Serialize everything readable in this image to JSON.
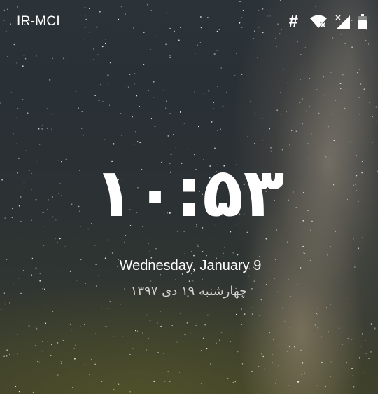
{
  "status_bar": {
    "carrier": "IR-MCI",
    "icons": [
      "hash-icon",
      "wifi-no-internet-icon",
      "cell-signal-no-service-icon",
      "battery-icon"
    ],
    "hash_glyph": "#"
  },
  "lockscreen": {
    "time": "۱۰:۵۳",
    "date": "Wednesday, January 9",
    "persian_date": "چهارشنبه ۱۹ دی ۱۳۹۷"
  },
  "colors": {
    "text": "#ffffff",
    "sky_dark": "#2a3034",
    "milky_way": "#afa08c"
  }
}
